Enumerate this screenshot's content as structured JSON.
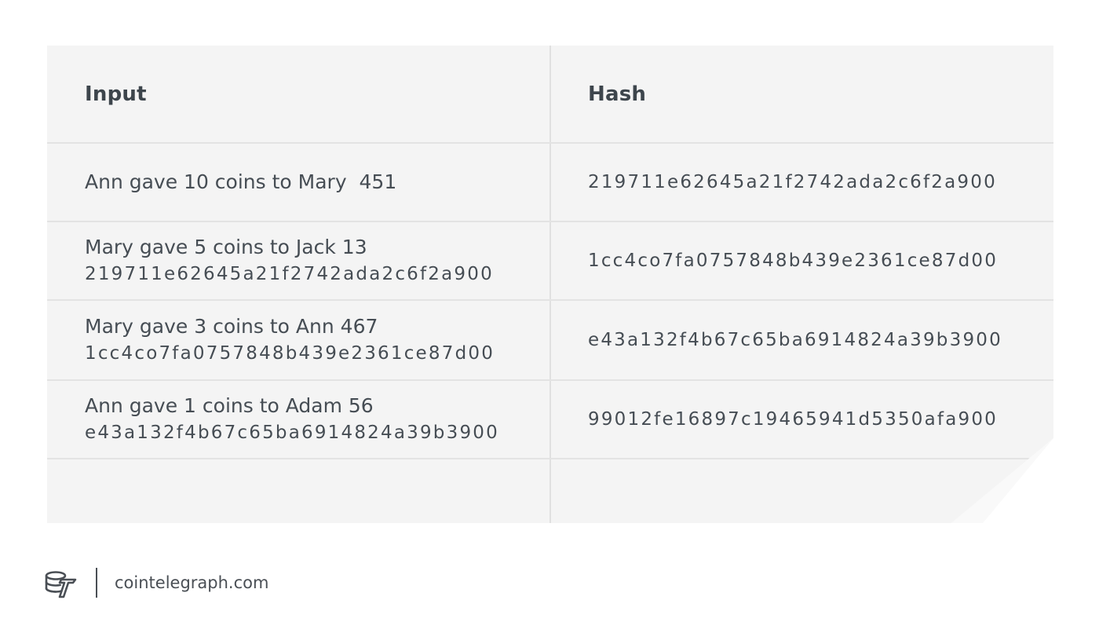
{
  "table": {
    "headers": {
      "input": "Input",
      "hash": "Hash"
    },
    "rows": [
      {
        "input_text": "Ann gave 10 coins to Mary  451",
        "input_prev_hash": "",
        "hash": "219711e62645a21f2742ada2c6f2a900"
      },
      {
        "input_text": "Mary gave 5 coins to Jack 13",
        "input_prev_hash": "219711e62645a21f2742ada2c6f2a900",
        "hash": "1cc4co7fa0757848b439e2361ce87d00"
      },
      {
        "input_text": "Mary gave 3 coins to Ann 467",
        "input_prev_hash": "1cc4co7fa0757848b439e2361ce87d00",
        "hash": "e43a132f4b67c65ba6914824a39b3900"
      },
      {
        "input_text": "Ann gave 1 coins to Adam 56",
        "input_prev_hash": "e43a132f4b67c65ba6914824a39b3900",
        "hash": "99012fe16897c19465941d5350afa900"
      }
    ]
  },
  "footer": {
    "logo_icon": "cointelegraph-logo-icon",
    "site": "cointelegraph.com"
  },
  "colors": {
    "table_bg": "#f4f4f4",
    "divider": "#e3e3e3",
    "text": "#464d54",
    "header_text": "#3d454c"
  }
}
